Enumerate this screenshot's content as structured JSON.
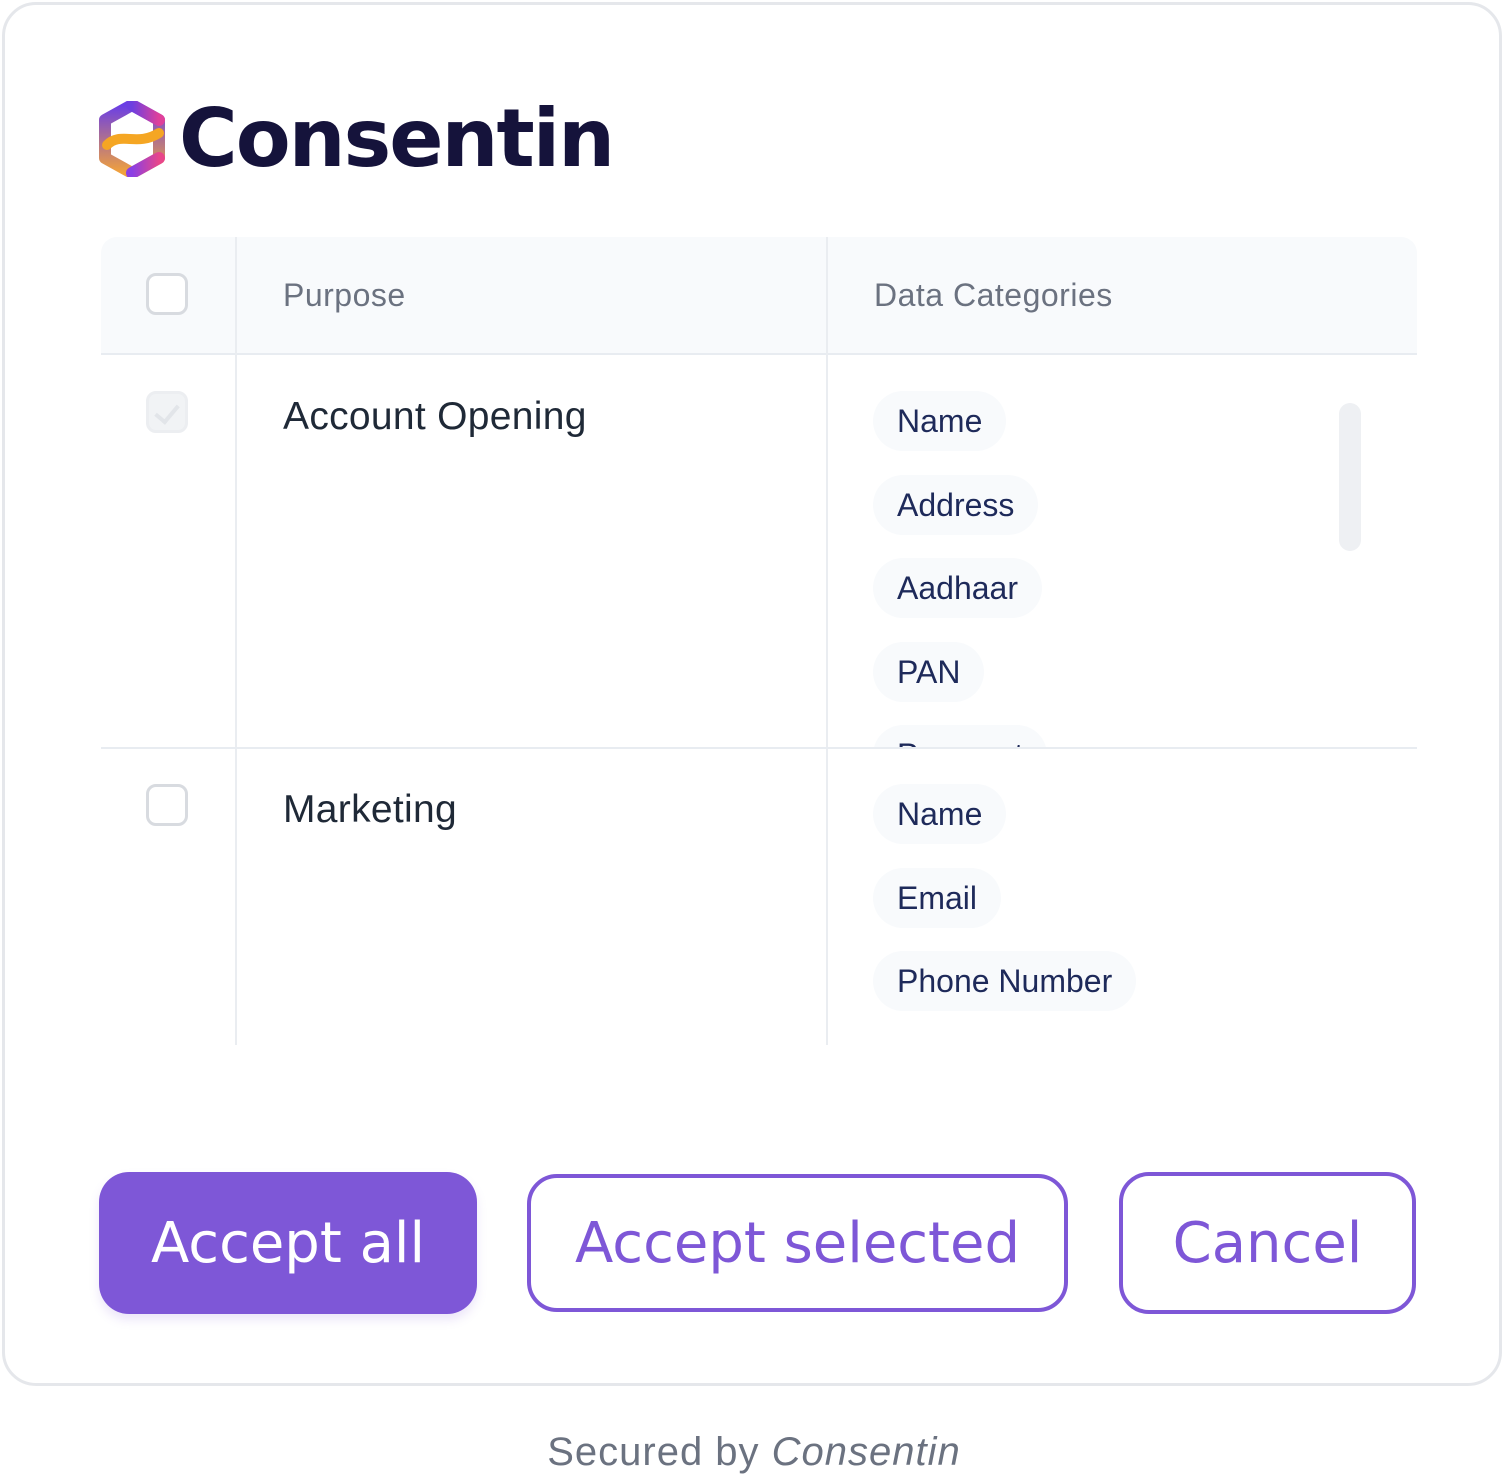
{
  "brand": {
    "name": "Consentin",
    "logo_icon": "consentin-hexagon-logo"
  },
  "table": {
    "headers": {
      "purpose": "Purpose",
      "data_categories": "Data Categories"
    },
    "rows": [
      {
        "purpose": "Account Opening",
        "checked": true,
        "disabled": true,
        "categories": [
          "Name",
          "Address",
          "Aadhaar",
          "PAN",
          "Passport"
        ]
      },
      {
        "purpose": "Marketing",
        "checked": false,
        "disabled": false,
        "categories": [
          "Name",
          "Email",
          "Phone Number"
        ]
      }
    ]
  },
  "buttons": {
    "accept_all": "Accept all",
    "accept_selected": "Accept selected",
    "cancel": "Cancel"
  },
  "footer": {
    "prefix": "Secured by",
    "brand": "Consentin"
  },
  "colors": {
    "accent": "#7e57d7",
    "brand_text": "#15133b",
    "chip_text": "#1e2a5a"
  }
}
